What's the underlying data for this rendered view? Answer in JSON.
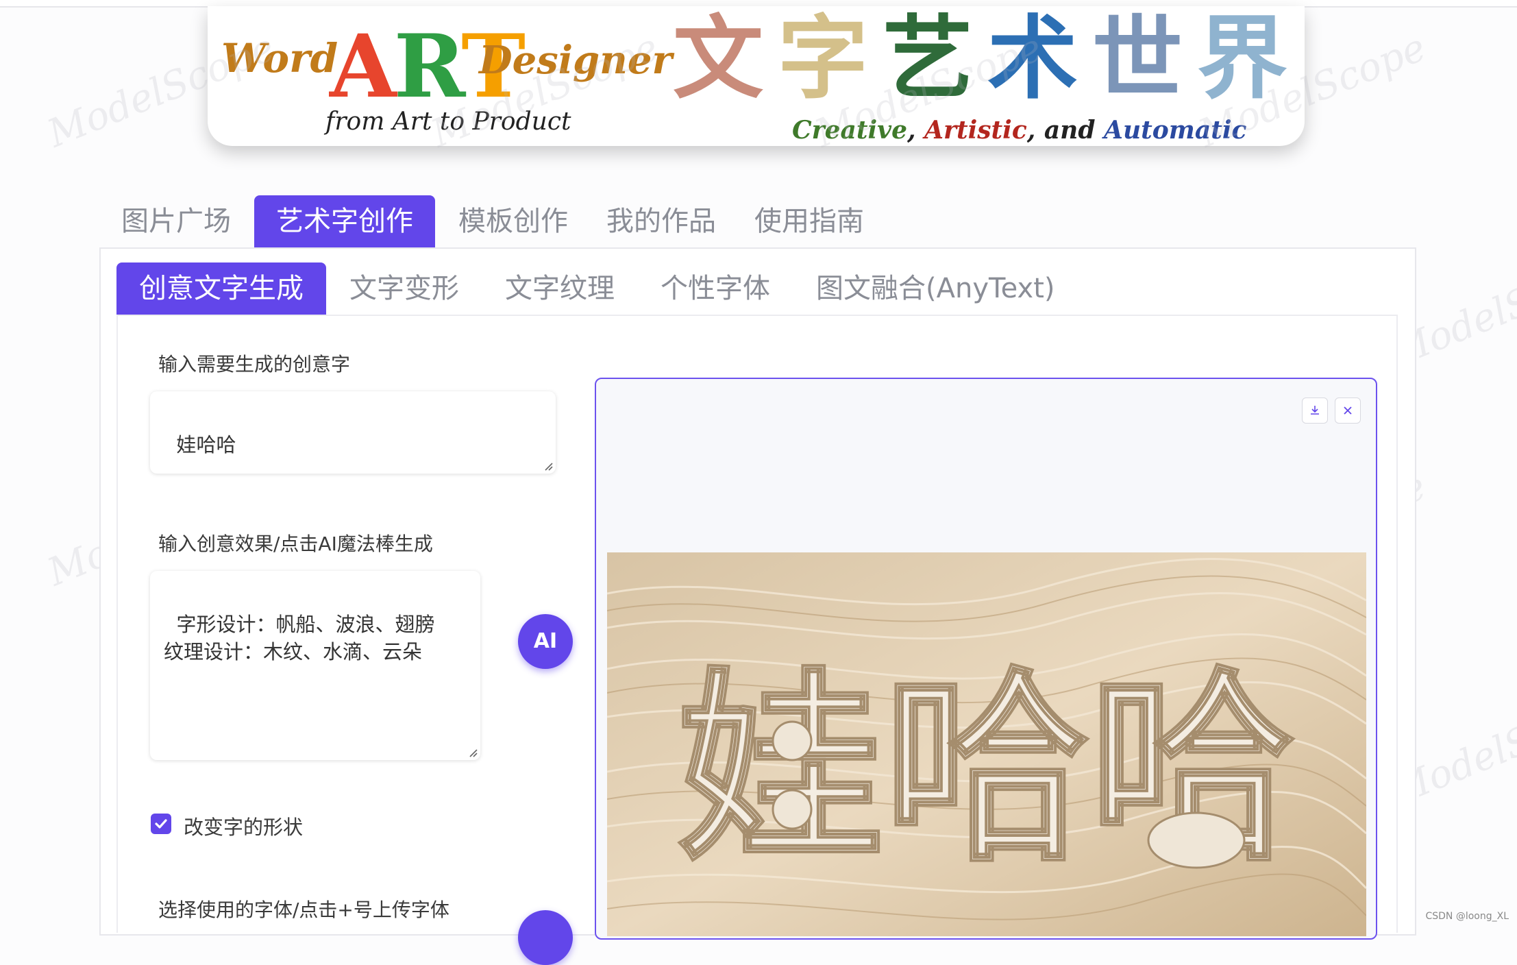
{
  "banner": {
    "word": "Word",
    "art": [
      "A",
      "R",
      "T"
    ],
    "designer": "Designer",
    "subtitle": "from Art to Product",
    "cn_chars": [
      "文",
      "字",
      "艺",
      "术",
      "世",
      "界"
    ],
    "slogan": {
      "creative": "Creative",
      "sep1": ", ",
      "artistic": "Artistic",
      "sep2": ", and ",
      "automatic": "Automatic"
    }
  },
  "watermark": "ModelScope",
  "tabs": [
    {
      "label": "图片广场",
      "active": false
    },
    {
      "label": "艺术字创作",
      "active": true
    },
    {
      "label": "模板创作",
      "active": false
    },
    {
      "label": "我的作品",
      "active": false
    },
    {
      "label": "使用指南",
      "active": false
    }
  ],
  "subtabs": [
    {
      "label": "创意文字生成",
      "active": true
    },
    {
      "label": "文字变形",
      "active": false
    },
    {
      "label": "文字纹理",
      "active": false
    },
    {
      "label": "个性字体",
      "active": false
    },
    {
      "label": "图文融合(AnyText)",
      "active": false
    }
  ],
  "form": {
    "text_label": "输入需要生成的创意字",
    "text_value": "娃哈哈",
    "prompt_label": "输入创意效果/点击AI魔法棒生成",
    "prompt_value": "字形设计：帆船、波浪、翅膀\n纹理设计：木纹、水滴、云朵",
    "ai_button": "AI",
    "shape_checkbox_label": "改变字的形状",
    "shape_checked": true,
    "font_label": "选择使用的字体/点击+号上传字体"
  },
  "result": {
    "download_icon": "download-icon",
    "close_icon": "close-icon",
    "image_text": "娃哈哈"
  },
  "footer": {
    "credit": "CSDN @loong_XL"
  },
  "colors": {
    "accent": "#6246ea",
    "tab_inactive": "#8a8d96",
    "sand": "#e8d7bd"
  }
}
